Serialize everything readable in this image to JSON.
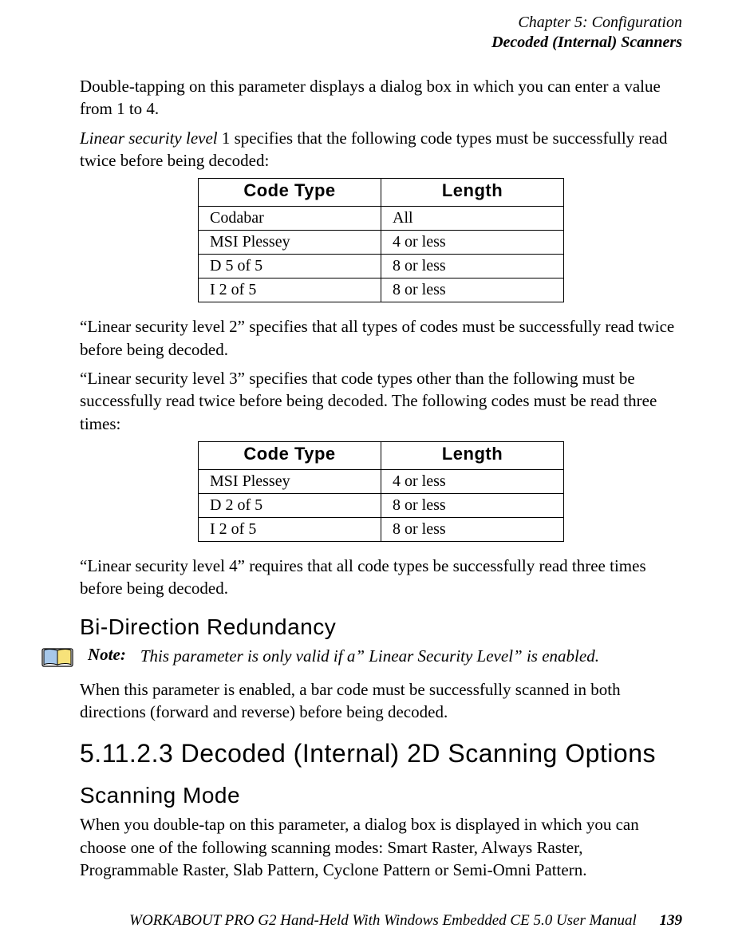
{
  "header": {
    "chapter": "Chapter 5: Configuration",
    "section": "Decoded (Internal) Scanners"
  },
  "paragraphs": {
    "p1": "Double-tapping on this parameter displays a dialog box in which you can enter a value from 1 to 4.",
    "p2_prefix_italic": "Linear security level",
    "p2_rest": " 1 specifies that the following code types must be successfully read twice before being decoded:",
    "p3": "“Linear security level 2” specifies that all types of codes must be successfully read twice before being decoded.",
    "p4": "“Linear security level 3” specifies that code types other than the following must be successfully read twice before being decoded. The following codes must be read three times:",
    "p5": "“Linear security level 4” requires that all code types be successfully read three times before being decoded.",
    "p6": "When this parameter is enabled, a bar code must be successfully scanned in both directions (forward and reverse) before being decoded.",
    "p7": "When you double-tap on this parameter, a dialog box is displayed in which you can choose one of the following scanning modes: Smart Raster, Always Raster, Programmable Raster, Slab Pattern, Cyclone Pattern or Semi-Omni Pattern."
  },
  "tables": {
    "headers": {
      "code_type": "Code Type",
      "length": "Length"
    },
    "t1": [
      {
        "type": "Codabar",
        "length": "All"
      },
      {
        "type": "MSI Plessey",
        "length": "4 or less"
      },
      {
        "type": "D 5 of 5",
        "length": "8 or less"
      },
      {
        "type": "I 2 of 5",
        "length": "8 or less"
      }
    ],
    "t2": [
      {
        "type": "MSI Plessey",
        "length": "4 or less"
      },
      {
        "type": "D 2 of 5",
        "length": "8 or less"
      },
      {
        "type": "I 2 of 5",
        "length": "8 or less"
      }
    ]
  },
  "headings": {
    "bi_direction": "Bi-Direction Redundancy",
    "sec_number": "5.11.2.3   Decoded (Internal) 2D Scanning Options",
    "scanning_mode": "Scanning Mode"
  },
  "note": {
    "label": "Note:",
    "text": "This parameter is only valid if a” Linear Security Level” is enabled."
  },
  "footer": {
    "manual": "WORKABOUT PRO G2 Hand-Held With Windows Embedded CE 5.0 User Manual",
    "page": "139"
  }
}
